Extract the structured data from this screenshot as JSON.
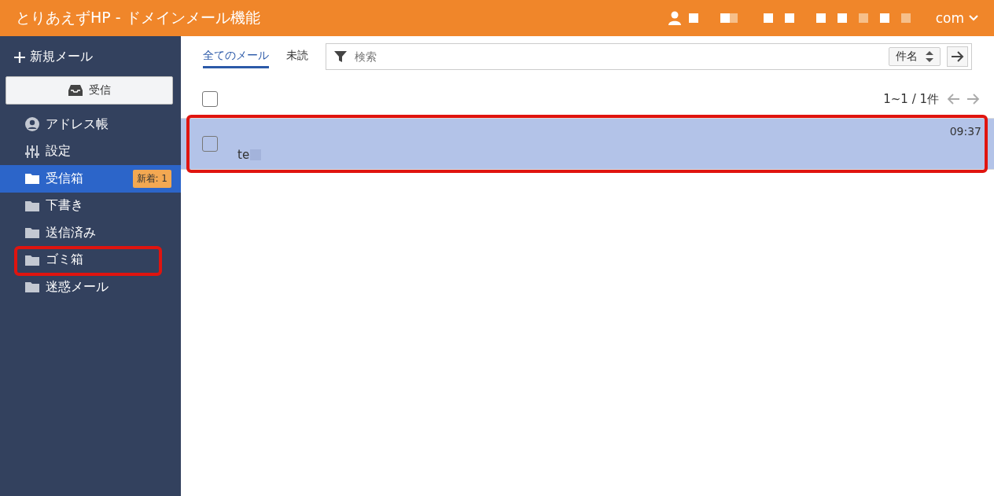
{
  "header": {
    "title": "とりあえずHP - ドメインメール機能",
    "account": "com"
  },
  "sidebar": {
    "compose": "新規メール",
    "receive_button": "受信",
    "items": [
      {
        "kind": "contacts",
        "label": "アドレス帳",
        "selected": false,
        "highlighted": false
      },
      {
        "kind": "settings",
        "label": "設定",
        "selected": false,
        "highlighted": false
      },
      {
        "kind": "folder",
        "label": "受信箱",
        "selected": true,
        "highlighted": false,
        "badge": "新着: 1"
      },
      {
        "kind": "folder",
        "label": "下書き",
        "selected": false,
        "highlighted": false
      },
      {
        "kind": "folder",
        "label": "送信済み",
        "selected": false,
        "highlighted": false
      },
      {
        "kind": "folder",
        "label": "ゴミ箱",
        "selected": false,
        "highlighted": true
      },
      {
        "kind": "folder",
        "label": "迷惑メール",
        "selected": false,
        "highlighted": false
      }
    ]
  },
  "tabs": [
    {
      "label": "全てのメール",
      "selected": true
    },
    {
      "label": "未読",
      "selected": false
    }
  ],
  "search": {
    "placeholder": "検索"
  },
  "sort": {
    "value": "件名"
  },
  "select_all": {
    "checked": false
  },
  "pagination": "1~1 / 1件",
  "messages": [
    {
      "subject": "te",
      "time": "09:37",
      "checked": false,
      "selected": true,
      "highlighted": true
    }
  ]
}
